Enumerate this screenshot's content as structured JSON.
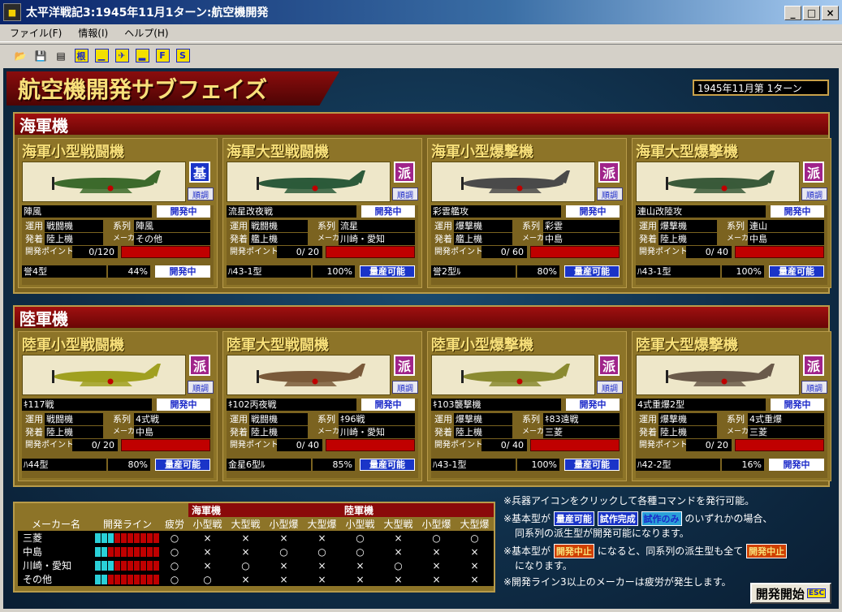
{
  "window": {
    "title": "太平洋戦記3:1945年11月1ターン:航空機開発",
    "app_icon": "game-icon"
  },
  "menu": [
    "ファイル(F)",
    "情報(I)",
    "ヘルプ(H)"
  ],
  "toolbar": {
    "icons": [
      "open-folder-icon",
      "save-icon",
      "document-icon",
      "base-icon",
      "carrier-icon",
      "plane-icon",
      "ship-icon",
      "fleet-icon",
      "supply-icon"
    ],
    "labels": [
      "",
      "",
      "",
      "根",
      "",
      "",
      "",
      "F",
      "S"
    ]
  },
  "phase_title": "航空機開発サブフェイズ",
  "turn": "1945年11月第 1ターン",
  "navy": {
    "section_title": "海軍機",
    "cards": [
      {
        "title": "海軍小型戦闘機",
        "badge": "基",
        "badge_type": "base",
        "juncho": "順調",
        "name": "陣風",
        "status": "開発中",
        "type_label": "運用",
        "type": "戦闘機",
        "series_label": "系列",
        "series": "陣風",
        "origin_label": "発着",
        "origin": "陸上機",
        "maker_label": "メーカー",
        "maker": "その他",
        "points_label": "開発ポイント",
        "points": "0/120",
        "engine": "誉4型",
        "percent": "44%",
        "prod": "開発中",
        "prod_type": "dev",
        "plane_color": "#3c6a2c"
      },
      {
        "title": "海軍大型戦闘機",
        "badge": "派",
        "badge_type": "deriv",
        "juncho": "順調",
        "name": "流星改夜戦",
        "status": "開発中",
        "type_label": "運用",
        "type": "戦闘機",
        "series_label": "系列",
        "series": "流星",
        "origin_label": "発着",
        "origin": "艦上機",
        "maker_label": "メーカー",
        "maker": "川崎・愛知",
        "points_label": "開発ポイント",
        "points": "0/ 20",
        "engine": "ﾊ43-1型",
        "percent": "100%",
        "prod": "量産可能",
        "prod_type": "mass",
        "plane_color": "#2c5a3a"
      },
      {
        "title": "海軍小型爆撃機",
        "badge": "派",
        "badge_type": "deriv",
        "juncho": "順調",
        "name": "彩雲艦攻",
        "status": "開発中",
        "type_label": "運用",
        "type": "爆撃機",
        "series_label": "系列",
        "series": "彩雲",
        "origin_label": "発着",
        "origin": "艦上機",
        "maker_label": "メーカー",
        "maker": "中島",
        "points_label": "開発ポイント",
        "points": "0/ 60",
        "engine": "誉2型ﾙ",
        "percent": "80%",
        "prod": "量産可能",
        "prod_type": "mass",
        "plane_color": "#4a4a4a"
      },
      {
        "title": "海軍大型爆撃機",
        "badge": "派",
        "badge_type": "deriv",
        "juncho": "順調",
        "name": "連山改陸攻",
        "status": "開発中",
        "type_label": "運用",
        "type": "爆撃機",
        "series_label": "系列",
        "series": "連山",
        "origin_label": "発着",
        "origin": "陸上機",
        "maker_label": "メーカー",
        "maker": "中島",
        "points_label": "開発ポイント",
        "points": "0/ 40",
        "engine": "ﾊ43-1型",
        "percent": "100%",
        "prod": "量産可能",
        "prod_type": "mass",
        "plane_color": "#3a5a3a"
      }
    ]
  },
  "army": {
    "section_title": "陸軍機",
    "cards": [
      {
        "title": "陸軍小型戦闘機",
        "badge": "派",
        "badge_type": "deriv",
        "juncho": "順調",
        "name": "ｷ117戦",
        "status": "開発中",
        "type_label": "運用",
        "type": "戦闘機",
        "series_label": "系列",
        "series": "4式戦",
        "origin_label": "発着",
        "origin": "陸上機",
        "maker_label": "メーカー",
        "maker": "中島",
        "points_label": "開発ポイント",
        "points": "0/ 20",
        "engine": "ﾊ44型",
        "percent": "80%",
        "prod": "量産可能",
        "prod_type": "mass",
        "plane_color": "#a0a020"
      },
      {
        "title": "陸軍大型戦闘機",
        "badge": "派",
        "badge_type": "deriv",
        "juncho": "順調",
        "name": "ｷ102丙夜戦",
        "status": "開発中",
        "type_label": "運用",
        "type": "戦闘機",
        "series_label": "系列",
        "series": "ｷ96戦",
        "origin_label": "発着",
        "origin": "陸上機",
        "maker_label": "メーカー",
        "maker": "川崎・愛知",
        "points_label": "開発ポイント",
        "points": "0/ 40",
        "engine": "金星6型ﾙ",
        "percent": "85%",
        "prod": "量産可能",
        "prod_type": "mass",
        "plane_color": "#7a5a3a"
      },
      {
        "title": "陸軍小型爆撃機",
        "badge": "派",
        "badge_type": "deriv",
        "juncho": "順調",
        "name": "ｷ103襲撃機",
        "status": "開発中",
        "type_label": "運用",
        "type": "爆撃機",
        "series_label": "系列",
        "series": "ｷ83遠戦",
        "origin_label": "発着",
        "origin": "陸上機",
        "maker_label": "メーカー",
        "maker": "三菱",
        "points_label": "開発ポイント",
        "points": "0/ 40",
        "engine": "ﾊ43-1型",
        "percent": "100%",
        "prod": "量産可能",
        "prod_type": "mass",
        "plane_color": "#8a8a30"
      },
      {
        "title": "陸軍大型爆撃機",
        "badge": "派",
        "badge_type": "deriv",
        "juncho": "順調",
        "name": "4式重爆2型",
        "status": "開発中",
        "type_label": "運用",
        "type": "爆撃機",
        "series_label": "系列",
        "series": "4式重爆",
        "origin_label": "発着",
        "origin": "陸上機",
        "maker_label": "メーカー",
        "maker": "三菱",
        "points_label": "開発ポイント",
        "points": "0/ 20",
        "engine": "ﾊ42-2型",
        "percent": "16%",
        "prod": "開発中",
        "prod_type": "dev",
        "plane_color": "#6a5a4a"
      }
    ]
  },
  "maker_table": {
    "headers": {
      "maker": "メーカー名",
      "line": "開発ライン",
      "fatigue": "疲労",
      "navy": "海軍機",
      "army": "陸軍機"
    },
    "sub_headers": [
      "小型戦",
      "大型戦",
      "小型爆",
      "大型爆",
      "小型戦",
      "大型戦",
      "小型爆",
      "大型爆"
    ],
    "rows": [
      {
        "name": "三菱",
        "cyan": 3,
        "red": 7,
        "fatigue": "○",
        "cells": [
          "×",
          "×",
          "×",
          "×",
          "○",
          "×",
          "○",
          "○"
        ]
      },
      {
        "name": "中島",
        "cyan": 2,
        "red": 8,
        "fatigue": "○",
        "cells": [
          "×",
          "×",
          "○",
          "○",
          "○",
          "×",
          "×",
          "×"
        ]
      },
      {
        "name": "川崎・愛知",
        "cyan": 3,
        "red": 7,
        "fatigue": "○",
        "cells": [
          "×",
          "○",
          "×",
          "×",
          "×",
          "○",
          "×",
          "×"
        ]
      },
      {
        "name": "その他",
        "cyan": 2,
        "red": 8,
        "fatigue": "○",
        "cells": [
          "○",
          "×",
          "×",
          "×",
          "×",
          "×",
          "×",
          "×"
        ]
      }
    ]
  },
  "notes": {
    "n1": "※兵器アイコンをクリックして各種コマンドを発行可能。",
    "n2a": "※基本型が",
    "b_mass": "量産可能",
    "b_trial": "試作完成",
    "b_only": "試作のみ",
    "n2b": "のいずれかの場合、",
    "n2c": "同系列の派生型が開発可能になります。",
    "n3a": "※基本型が",
    "b_stop": "開発中止",
    "n3b": "になると、同系列の派生型も全て",
    "n3c": "になります。",
    "n4": "※開発ライン3以上のメーカーは疲労が発生します。"
  },
  "start_button": {
    "label": "開発開始",
    "esc": "ESC"
  },
  "colors": {
    "accent": "#8a0a0a",
    "gold": "#8d7428",
    "blue": "#1a34c8"
  }
}
